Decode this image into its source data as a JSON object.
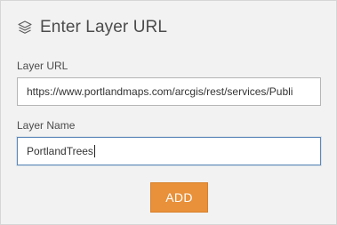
{
  "header": {
    "icon": "layers-icon",
    "title": "Enter Layer URL"
  },
  "form": {
    "url_label": "Layer URL",
    "url_value": "https://www.portlandmaps.com/arcgis/rest/services/Publi",
    "name_label": "Layer Name",
    "name_value": "PortlandTrees"
  },
  "actions": {
    "add_label": "ADD"
  },
  "colors": {
    "panel_bg": "#f2f2f2",
    "accent": "#e8913a",
    "focus_border": "#5b87b8"
  }
}
